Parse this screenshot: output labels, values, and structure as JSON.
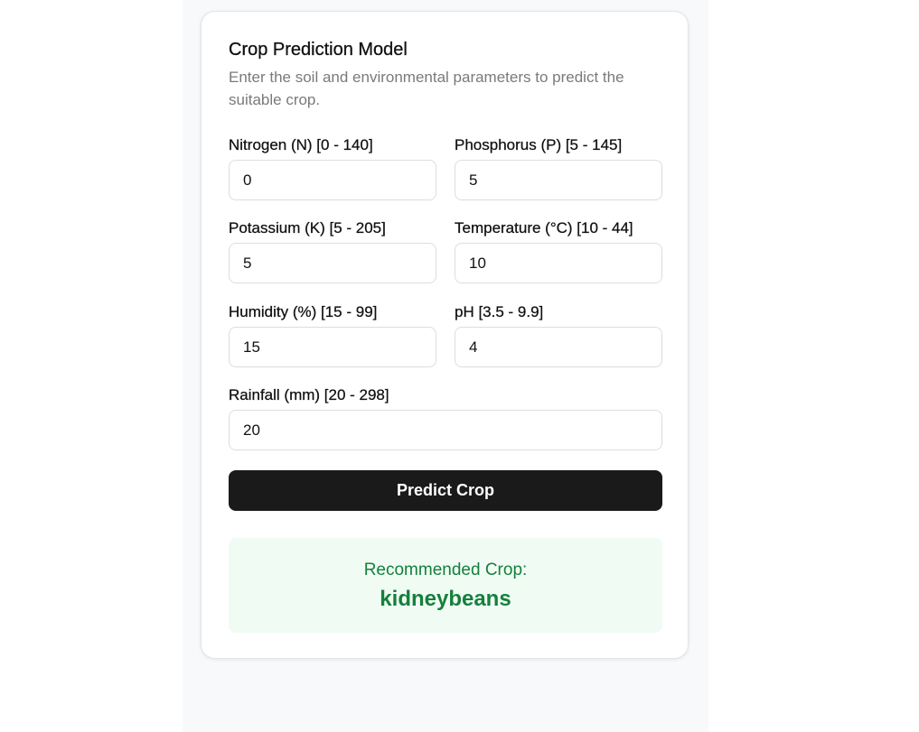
{
  "form": {
    "title": "Crop Prediction Model",
    "description": "Enter the soil and environmental parameters to predict the suitable crop.",
    "fields": [
      {
        "label": "Nitrogen (N) [0 - 140]",
        "value": "0"
      },
      {
        "label": "Phosphorus (P) [5 - 145]",
        "value": "5"
      },
      {
        "label": "Potassium (K) [5 - 205]",
        "value": "5"
      },
      {
        "label": "Temperature (°C) [10 - 44]",
        "value": "10"
      },
      {
        "label": "Humidity (%) [15 - 99]",
        "value": "15"
      },
      {
        "label": "pH [3.5 - 9.9]",
        "value": "4"
      },
      {
        "label": "Rainfall (mm) [20 - 298]",
        "value": "20"
      }
    ],
    "submit_label": "Predict Crop"
  },
  "result": {
    "label": "Recommended Crop:",
    "crop": "kidneybeans"
  },
  "colors": {
    "button_bg": "#1a1a1a",
    "result_bg": "#f0fbf3",
    "result_text": "#15803d"
  }
}
